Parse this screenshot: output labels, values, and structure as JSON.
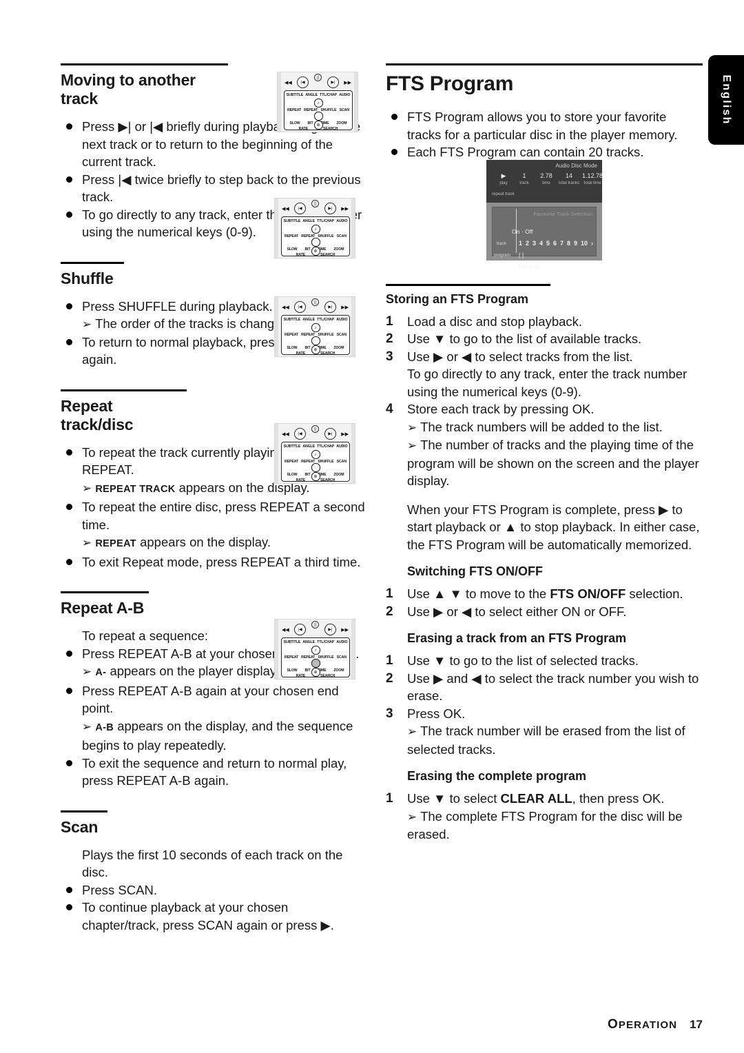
{
  "language_tab": "English",
  "footer": {
    "section": "PERATION",
    "section_first_letter": "O",
    "page": "17"
  },
  "left_column": {
    "sections": [
      {
        "heading": "Moving to another track",
        "items": [
          {
            "type": "bullet",
            "text": "Press ▶| or |◀ briefly during playback to go to the next track or to return to the beginning of the current track."
          },
          {
            "type": "bullet",
            "text": "Press |◀ twice briefly to step back to the previous track."
          },
          {
            "type": "bullet",
            "text": "To go directly to any track, enter the track number using the numerical keys (0-9)."
          }
        ]
      },
      {
        "heading": "Shuffle",
        "items": [
          {
            "type": "bullet",
            "text": "Press SHUFFLE during playback."
          },
          {
            "type": "arrow",
            "text": "The order of the tracks is changed."
          },
          {
            "type": "bullet",
            "text": "To return to normal playback, press SHUFFLE again."
          }
        ]
      },
      {
        "heading": "Repeat track/disc",
        "items": [
          {
            "type": "bullet",
            "text": "To repeat the track currently playing, press REPEAT."
          },
          {
            "type": "arrow",
            "caps": "REPEAT TRACK",
            "text": "appears on the display."
          },
          {
            "type": "bullet",
            "text": "To repeat the entire disc, press REPEAT a second time."
          },
          {
            "type": "arrow",
            "caps": "REPEAT",
            "text": "appears on the display."
          },
          {
            "type": "bullet",
            "text": "To exit Repeat mode, press REPEAT a third time."
          }
        ]
      },
      {
        "heading": "Repeat A-B",
        "items": [
          {
            "type": "plain",
            "text": "To repeat a sequence:"
          },
          {
            "type": "bullet",
            "text": "Press REPEAT A-B at your chosen starting point."
          },
          {
            "type": "arrow",
            "caps": "A-",
            "text": "appears on the player display."
          },
          {
            "type": "bullet",
            "text": "Press REPEAT A-B again at your chosen end point."
          },
          {
            "type": "arrow",
            "caps": "A-B",
            "text": "appears on the display, and the sequence begins to play repeatedly."
          },
          {
            "type": "bullet",
            "text": "To exit the sequence and return to normal play, press REPEAT A-B again."
          }
        ]
      },
      {
        "heading": "Scan",
        "items": [
          {
            "type": "plain",
            "text": "Plays the first 10 seconds of each track on the disc."
          },
          {
            "type": "bullet",
            "text": "Press SCAN."
          },
          {
            "type": "bullet",
            "text": "To continue playback at your chosen chapter/track, press SCAN again or press ▶."
          }
        ]
      }
    ],
    "remotes": [
      {
        "name": "remote-moving-to-another-track",
        "highlight": "none"
      },
      {
        "name": "remote-shuffle",
        "highlight": "time"
      },
      {
        "name": "remote-repeat",
        "highlight": "slow"
      },
      {
        "name": "remote-repeat-ab",
        "highlight": "bit"
      },
      {
        "name": "remote-scan",
        "highlight": "zoom"
      }
    ],
    "remote_labels": {
      "top_row": [
        "SUBTITLE",
        "ANGLE",
        "TTL/CHAP",
        "AUDIO"
      ],
      "row2": [
        "REPEAT",
        "REPEAT",
        "SHUFFLE",
        "SCAN"
      ],
      "row3": [
        "SLOW",
        "BIT",
        "TIME",
        "ZOOM"
      ],
      "row4": [
        "RATE",
        "SEARCH"
      ],
      "glyphs": {
        "rewind": "◀◀",
        "prev": "|◀",
        "pause": "||",
        "next": "▶|",
        "forward": "▶▶",
        "play": "▶",
        "search": "⊕",
        "repeat_ab": "A-B",
        "ttl_chap": "T·C"
      }
    }
  },
  "right_column": {
    "title": "FTS Program",
    "intro": [
      "FTS Program allows you to store your favorite tracks for a particular disc in the player memory.",
      "Each FTS Program can contain 20 tracks."
    ],
    "tv_screen": {
      "mode": "Audio Disc Mode",
      "play_icon": "▶",
      "fields": [
        {
          "value": "",
          "key": "play"
        },
        {
          "value": "1",
          "key": "track"
        },
        {
          "value": "2.78",
          "key": "time"
        },
        {
          "value": "14",
          "key": "total tracks"
        },
        {
          "value": "1.12.78",
          "key": "total time"
        }
      ],
      "status": "repeat track",
      "panel_title": "Favourite Track Selection",
      "on_off": "On · Off",
      "track_label": "track",
      "program_label": "program",
      "tracks": [
        "1",
        "2",
        "3",
        "4",
        "5",
        "6",
        "7",
        "8",
        "9",
        "10"
      ],
      "tracks_more": "›",
      "program_value": "[ ]",
      "clear_all": "Clear all"
    },
    "sections": [
      {
        "heading": "Storing an FTS Program",
        "ruled": true,
        "items": [
          {
            "type": "num",
            "n": "1",
            "text": "Load a disc and stop playback."
          },
          {
            "type": "num",
            "n": "2",
            "text": "Use ▼ to go to the list of available tracks."
          },
          {
            "type": "num",
            "n": "3",
            "text": "Use ▶ or ◀ to select tracks from the list."
          },
          {
            "type": "plain",
            "text": "To go directly to any track, enter the track number using the numerical keys (0-9)."
          },
          {
            "type": "num",
            "n": "4",
            "text": "Store each track by pressing OK."
          },
          {
            "type": "arrow",
            "text": "The track numbers will be added to the list."
          },
          {
            "type": "arrow",
            "text": "The number of tracks and the playing time of the program will be shown on the screen and the player display."
          },
          {
            "type": "para",
            "text": "When your FTS Program is complete, press ▶ to start playback or ▲ to stop playback. In either case, the FTS Program will be automatically memorized."
          }
        ]
      },
      {
        "heading": "Switching FTS ON/OFF",
        "ruled": false,
        "items": [
          {
            "type": "num",
            "n": "1",
            "text": "Use ▲ ▼ to move to the ",
            "bold": "FTS ON/OFF",
            "tail": " selection."
          },
          {
            "type": "num",
            "n": "2",
            "text": "Use ▶ or ◀ to select either ON or OFF."
          }
        ]
      },
      {
        "heading": "Erasing a track from an FTS Program",
        "ruled": false,
        "items": [
          {
            "type": "num",
            "n": "1",
            "text": "Use ▼ to go to the list of selected tracks."
          },
          {
            "type": "num",
            "n": "2",
            "text": "Use ▶ and ◀ to select the track number you wish to erase."
          },
          {
            "type": "num",
            "n": "3",
            "text": "Press OK."
          },
          {
            "type": "arrow",
            "text": "The track number will be erased from the list of selected tracks."
          }
        ]
      },
      {
        "heading": "Erasing the complete program",
        "ruled": false,
        "items": [
          {
            "type": "num",
            "n": "1",
            "text": "Use ▼ to select ",
            "bold": "CLEAR ALL",
            "tail": ", then press OK."
          },
          {
            "type": "arrow",
            "text": "The complete FTS Program for the disc will be erased."
          }
        ]
      }
    ]
  }
}
